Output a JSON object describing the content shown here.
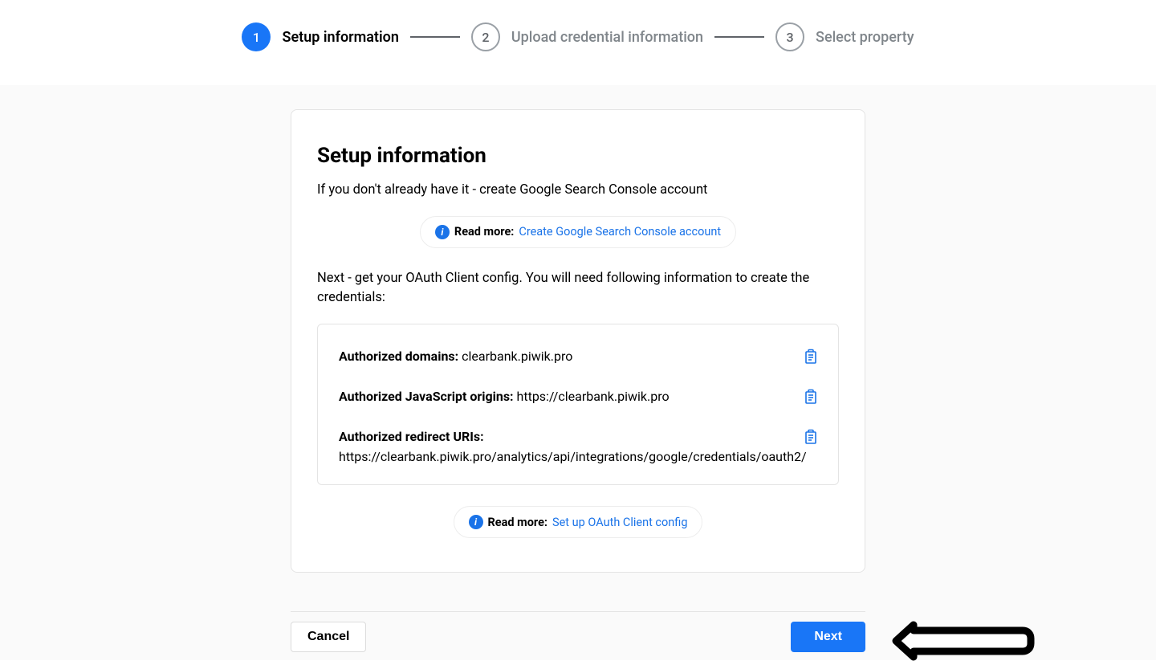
{
  "stepper": {
    "steps": [
      {
        "num": "1",
        "label": "Setup information",
        "active": true
      },
      {
        "num": "2",
        "label": "Upload credential information",
        "active": false
      },
      {
        "num": "3",
        "label": "Select property",
        "active": false
      }
    ]
  },
  "card": {
    "title": "Setup information",
    "intro": "If you don't already have it - create Google Search Console account",
    "readmore1": {
      "label": "Read more:",
      "link_text": "Create Google Search Console account"
    },
    "oauth_intro": "Next - get your OAuth Client config. You will need following information to create the credentials:",
    "config": [
      {
        "label": "Authorized domains:",
        "value": "clearbank.piwik.pro"
      },
      {
        "label": "Authorized JavaScript origins:",
        "value": "https://clearbank.piwik.pro"
      },
      {
        "label": "Authorized redirect URIs:",
        "value": "https://clearbank.piwik.pro/analytics/api/integrations/google/credentials/oauth2/"
      }
    ],
    "readmore2": {
      "label": "Read more:",
      "link_text": "Set up OAuth Client config"
    }
  },
  "footer": {
    "cancel": "Cancel",
    "next": "Next"
  }
}
